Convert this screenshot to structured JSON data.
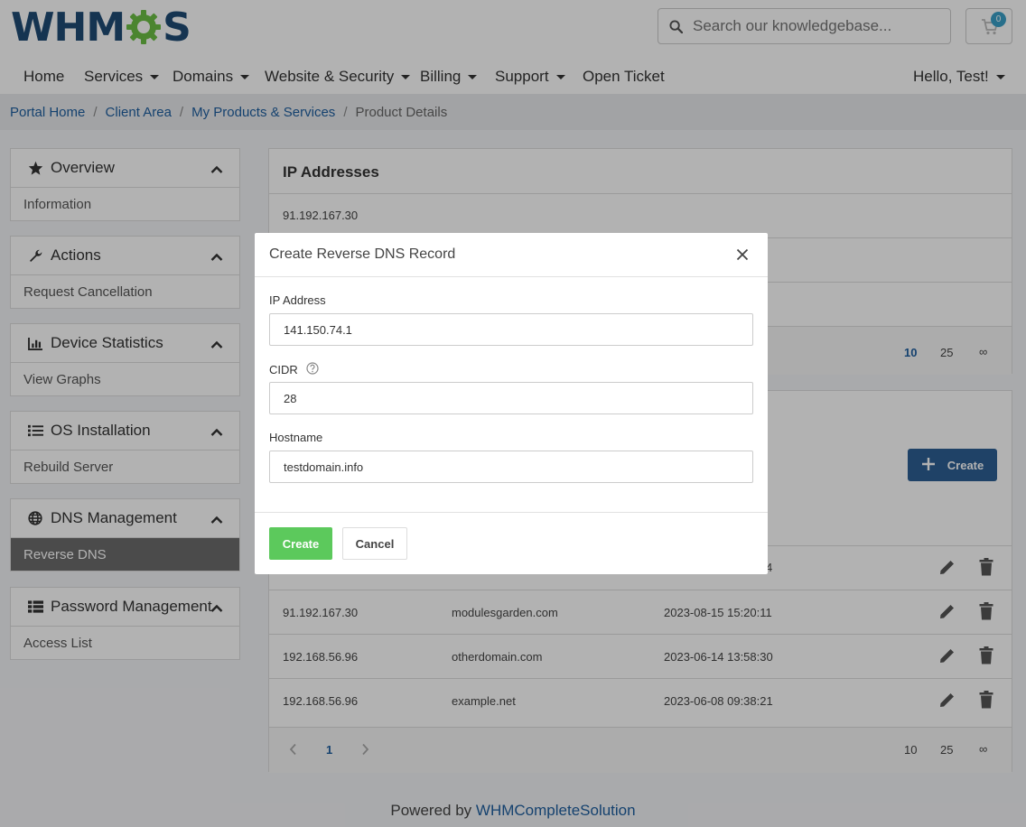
{
  "header": {
    "logo_left": "WHM",
    "logo_right": "S",
    "search": {
      "placeholder": "Search our knowledgebase..."
    },
    "cart": {
      "count": "0"
    },
    "colors": {
      "brand": "#1f4b74",
      "gear": "#6cbf45",
      "badge": "#3aa0c8"
    }
  },
  "nav": {
    "items": [
      {
        "label": "Home",
        "dropdown": false
      },
      {
        "label": "Services",
        "dropdown": true
      },
      {
        "label": "Domains",
        "dropdown": true
      },
      {
        "label": "Website & Security",
        "dropdown": true
      },
      {
        "label": "Billing",
        "dropdown": true
      },
      {
        "label": "Support",
        "dropdown": true
      },
      {
        "label": "Open Ticket",
        "dropdown": false
      }
    ],
    "user": "Hello, Test!"
  },
  "breadcrumb": [
    "Portal Home",
    "Client Area",
    "My Products & Services",
    "Product Details"
  ],
  "sidebar": {
    "panels": [
      {
        "title": "Overview",
        "icon": "star-icon",
        "items": [
          "Information"
        ]
      },
      {
        "title": "Actions",
        "icon": "wrench-icon",
        "items": [
          "Request Cancellation"
        ]
      },
      {
        "title": "Device Statistics",
        "icon": "chart-icon",
        "items": [
          "View Graphs"
        ]
      },
      {
        "title": "OS Installation",
        "icon": "list-icon",
        "items": [
          "Rebuild Server"
        ]
      },
      {
        "title": "DNS Management",
        "icon": "globe-icon",
        "items": [
          "Reverse DNS"
        ]
      },
      {
        "title": "Password Management",
        "icon": "table-icon",
        "items": [
          "Access List"
        ]
      }
    ],
    "active_item": "Reverse DNS"
  },
  "ip_card": {
    "title": "IP Addresses",
    "rows": [
      "91.192.167.30"
    ],
    "page_sizes": [
      "10",
      "25",
      "∞"
    ]
  },
  "rdns_card": {
    "create_label": "Create",
    "partial_row_time_suffix": "4",
    "rows": [
      {
        "ip": "91.192.167.30",
        "hostname": "modulesgarden.com",
        "date": "2023-08-15 15:20:11"
      },
      {
        "ip": "192.168.56.96",
        "hostname": "otherdomain.com",
        "date": "2023-06-14 13:58:30"
      },
      {
        "ip": "192.168.56.96",
        "hostname": "example.net",
        "date": "2023-06-08 09:38:21"
      }
    ],
    "pagination": {
      "current": "1",
      "page_sizes": [
        "10",
        "25",
        "∞"
      ]
    }
  },
  "modal": {
    "title": "Create Reverse DNS Record",
    "fields": {
      "ip_label": "IP Address",
      "ip_value": "141.150.74.1",
      "cidr_label": "CIDR",
      "cidr_value": "28",
      "hostname_label": "Hostname",
      "hostname_value": "testdomain.info"
    },
    "create_label": "Create",
    "cancel_label": "Cancel",
    "colors": {
      "create": "#5cc95c",
      "overlay": "rgba(0,0,0,0.3)"
    }
  },
  "footer": {
    "prefix": "Powered by",
    "link": "WHMCompleteSolution"
  }
}
